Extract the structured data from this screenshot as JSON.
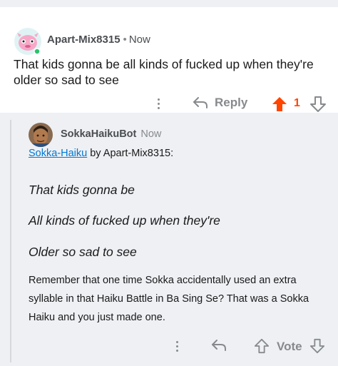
{
  "colors": {
    "upvote": "#ff4500",
    "link": "#0079d3",
    "muted": "#878a8c",
    "reply_bg": "#eef0f3"
  },
  "comment": {
    "author": "Apart-Mix8315",
    "separator": "•",
    "time": "Now",
    "body": "That kids gonna be all kinds of fucked up when they're older so sad to see",
    "actions": {
      "more_icon": "kebab-icon",
      "reply_label": "Reply",
      "upvote_icon": "upvote-arrow-icon",
      "vote_count": "1",
      "downvote_icon": "downvote-arrow-icon"
    }
  },
  "reply": {
    "author": "SokkaHaikuBot",
    "time": "Now",
    "byline_link": "Sokka-Haiku",
    "byline_rest": " by Apart-Mix8315:",
    "haiku_lines": [
      "That kids gonna be",
      "All kinds of fucked up when they're",
      "Older so sad to see"
    ],
    "note": "Remember that one time Sokka accidentally used an extra syllable in that Haiku Battle in Ba Sing Se? That was a Sokka Haiku and you just made one.",
    "actions": {
      "more_icon": "kebab-icon",
      "reply_icon": "reply-arrow-icon",
      "upvote_icon": "upvote-arrow-icon",
      "vote_label": "Vote",
      "downvote_icon": "downvote-arrow-icon"
    }
  }
}
